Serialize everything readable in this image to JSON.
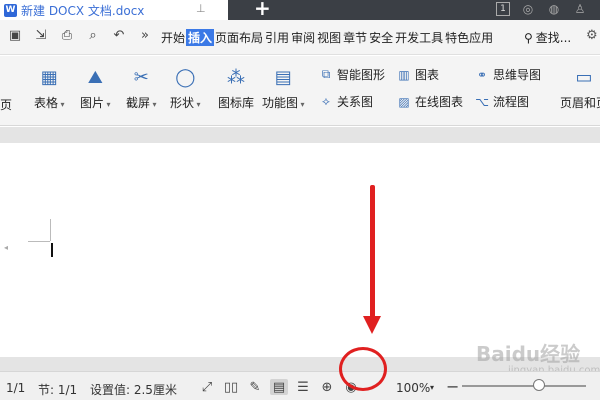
{
  "titlebar": {
    "doc_tab_title": "新建 DOCX 文档.docx",
    "doc_icon_letter": "W",
    "tab_count_badge": "1"
  },
  "menubar": {
    "tabs": [
      "开始",
      "插入",
      "页面布局",
      "引用",
      "审阅",
      "视图",
      "章节",
      "安全",
      "开发工具",
      "特色应用"
    ],
    "active_tab": "插入",
    "more_glyph": "»",
    "search_label": "查找..."
  },
  "ribbon": {
    "left_edge_label": "页",
    "table_label": "表格",
    "picture_label": "图片",
    "screenshot_label": "截屏",
    "shape_label": "形状",
    "icon_library_label": "图标库",
    "function_chart_label": "功能图",
    "smart_graphic_label": "智能图形",
    "chart_label": "图表",
    "mindmap_label": "思维导图",
    "relation_label": "关系图",
    "online_chart_label": "在线图表",
    "flowchart_label": "流程图",
    "header_footer_label": "页眉和页"
  },
  "status": {
    "page": "1/1",
    "section": "节: 1/1",
    "setting": "设置值: 2.5厘米",
    "zoom": "100%",
    "zoom_level_percent": 100
  },
  "watermark": {
    "brand": "Baidu经验",
    "url": "jingyan.baidu.com"
  },
  "colors": {
    "accent": "#3b79e6",
    "annotation": "#e02020",
    "dark_tabbar": "#3b3f45"
  }
}
